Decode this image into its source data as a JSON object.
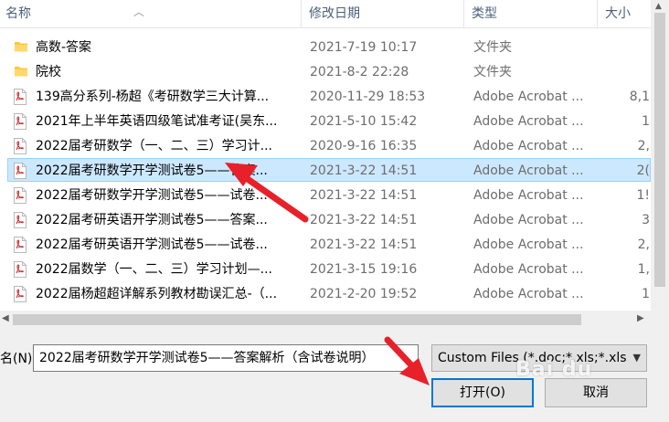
{
  "columns": {
    "name": "名称",
    "date": "修改日期",
    "type": "类型",
    "size": "大小"
  },
  "files": [
    {
      "icon": "folder-icon",
      "name": "高数-答案",
      "date": "2021-7-19 10:17",
      "type": "文件夹",
      "size": ""
    },
    {
      "icon": "folder-icon",
      "name": "院校",
      "date": "2021-8-2 22:28",
      "type": "文件夹",
      "size": ""
    },
    {
      "icon": "pdf-icon",
      "name": "139高分系列-杨超《考研数学三大计算...",
      "date": "2020-11-29 18:53",
      "type": "Adobe Acrobat ...",
      "size": "8,1"
    },
    {
      "icon": "pdf-icon",
      "name": "2021年上半年英语四级笔试准考证(吴东...",
      "date": "2021-5-10 15:42",
      "type": "Adobe Acrobat ...",
      "size": "1"
    },
    {
      "icon": "pdf-icon",
      "name": "2022届考研数学（一、二、三）学习计...",
      "date": "2020-9-16 16:35",
      "type": "Adobe Acrobat ...",
      "size": "2,"
    },
    {
      "icon": "pdf-icon",
      "name": "2022届考研数学开学测试卷5——答案...",
      "date": "2021-3-22 14:51",
      "type": "Adobe Acrobat ...",
      "size": "2(",
      "selected": true
    },
    {
      "icon": "pdf-icon",
      "name": "2022届考研数学开学测试卷5——试卷...",
      "date": "2021-3-22 14:51",
      "type": "Adobe Acrobat ...",
      "size": "1!"
    },
    {
      "icon": "pdf-icon",
      "name": "2022届考研英语开学测试卷5——答案...",
      "date": "2021-3-22 14:51",
      "type": "Adobe Acrobat ...",
      "size": "3"
    },
    {
      "icon": "pdf-icon",
      "name": "2022届考研英语开学测试卷5——试卷...",
      "date": "2021-3-22 14:51",
      "type": "Adobe Acrobat ...",
      "size": "2,"
    },
    {
      "icon": "pdf-icon",
      "name": "2022届数学（一、二、三）学习计划—...",
      "date": "2021-3-15 19:16",
      "type": "Adobe Acrobat ...",
      "size": "1,"
    },
    {
      "icon": "pdf-icon",
      "name": "2022届杨超超详解系列教材勘误汇总-（...",
      "date": "2021-2-20 19:52",
      "type": "Adobe Acrobat ...",
      "size": "1"
    }
  ],
  "filename": {
    "label": "名(N):",
    "value": "2022届考研数学开学测试卷5——答案解析（含试卷说明）"
  },
  "filter": {
    "selected": "Custom Files (*.doc;*.xls;*.xls"
  },
  "buttons": {
    "open": "打开(O)",
    "cancel": "取消"
  },
  "watermark": "Bai du",
  "colors": {
    "selection": "#cce8ff",
    "selection_border": "#99d1ff",
    "annotation_arrow": "#e8202a",
    "folder": "#ffc83d",
    "pdf": "#d32f2f"
  }
}
